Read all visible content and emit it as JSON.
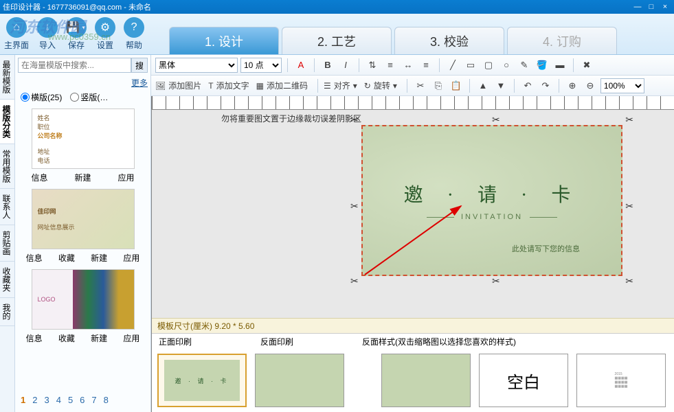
{
  "window": {
    "title": "佳印设计器 - 1677736091@qq.com - 未命名",
    "min": "—",
    "max": "□",
    "close": "×"
  },
  "menu": {
    "main": "主界面",
    "import": "导入",
    "save": "保存",
    "settings": "设置",
    "help": "帮助"
  },
  "steps": {
    "design": "1. 设计",
    "craft": "2. 工艺",
    "verify": "3. 校验",
    "order": "4. 订购"
  },
  "lefttabs": [
    "最新模版",
    "模版分类",
    "常用模版",
    "联系人",
    "剪贴画",
    "收藏夹",
    "我的"
  ],
  "search": {
    "placeholder": "在海量模版中搜索...",
    "btn": "搜"
  },
  "more": "更多",
  "orient": {
    "h": "横版(25)",
    "v": "竖版(…"
  },
  "tpl1": {
    "a1": "信息",
    "a2": "新建",
    "a3": "应用"
  },
  "tpl2": {
    "a1": "信息",
    "a2": "收藏",
    "a3": "新建",
    "a4": "应用"
  },
  "tpl3": {
    "a1": "信息",
    "a2": "收藏",
    "a3": "新建",
    "a4": "应用"
  },
  "pager": [
    "1",
    "2",
    "3",
    "4",
    "5",
    "6",
    "7",
    "8"
  ],
  "font": {
    "family": "黑体",
    "size": "10 点"
  },
  "tb2": {
    "addimg": "添加图片",
    "addtext": "添加文字",
    "qrcode": "添加二维码",
    "align": "对齐",
    "rotate": "旋转",
    "zoom": "100%"
  },
  "canvas": {
    "hint": "勿将重要图文置于边缘裁切误差阴影区",
    "title": "邀 · 请  · 卡",
    "subtitle": "INVITATION",
    "info": "此处请写下您的信息"
  },
  "dimbar": "模板尺寸(厘米) 9.20 * 5.60",
  "print": {
    "front": "正面印刷",
    "back": "反面印刷",
    "backstyle": "反面样式(双击缩略图以选择您喜欢的样式)",
    "blank": "空白",
    "mini_title": "邀 · 请 · 卡"
  },
  "watermark": "河东软件园",
  "wmurl": "www.pc0359.cn"
}
